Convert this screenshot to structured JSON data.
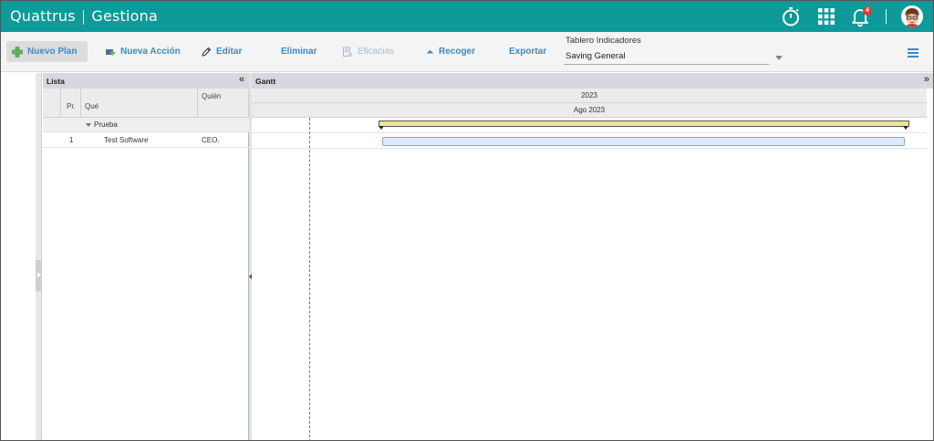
{
  "app": {
    "brand_name": "Quattrus",
    "brand_separator": "|",
    "brand_module": "Gestiona",
    "notification_count": "4",
    "accent_color": "#0d9a98"
  },
  "toolbar": {
    "nuevo_plan": "Nuevo Plan",
    "nueva_accion": "Nueva Acción",
    "editar": "Editar",
    "eliminar": "Eliminar",
    "eficacias": "Eficacias",
    "recoger": "Recoger",
    "exportar": "Exportar",
    "tablero_label": "Tablero Indicadores",
    "tablero_value": "Saving General"
  },
  "lista": {
    "title": "Lista",
    "columns": {
      "priority": "Pr.",
      "what": "Qué",
      "who": "Quién"
    },
    "rows": [
      {
        "type": "group",
        "priority": "",
        "what": "Prueba",
        "who": ""
      },
      {
        "type": "task",
        "priority": "1",
        "what": "Test Software",
        "who": "CEO."
      }
    ]
  },
  "gantt": {
    "title": "Gantt",
    "year": "2023",
    "month": "Ago 2023"
  },
  "icons": {
    "timer": "stopwatch-icon",
    "apps": "apps-grid-icon",
    "notifications": "bell-icon",
    "menu": "hamburger-menu-icon"
  }
}
